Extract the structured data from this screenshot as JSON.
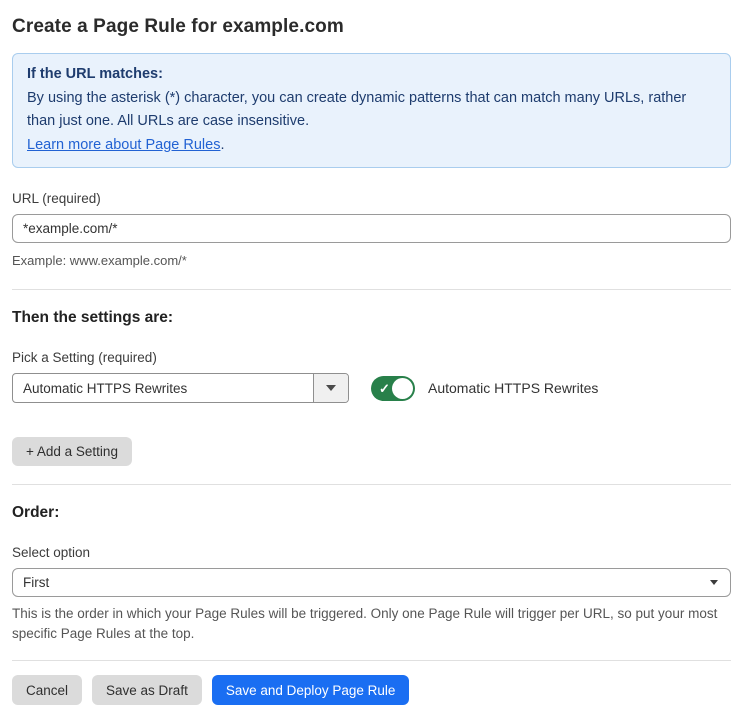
{
  "page": {
    "title": "Create a Page Rule for example.com"
  },
  "info_box": {
    "heading": "If the URL matches:",
    "body": "By using the asterisk (*) character, you can create dynamic patterns that can match many URLs, rather than just one. All URLs are case insensitive.",
    "link_label": "Learn more about Page Rules",
    "link_suffix": ".",
    "background_color": "#e9f2fc",
    "text_color": "#1e3c6e",
    "link_color": "#2262d3"
  },
  "url_field": {
    "label": "URL (required)",
    "value": "*example.com/*",
    "helper": "Example: www.example.com/*"
  },
  "settings_section": {
    "heading": "Then the settings are:",
    "picker_label": "Pick a Setting (required)",
    "selected_setting": "Automatic HTTPS Rewrites",
    "toggle": {
      "state": "on",
      "label": "Automatic HTTPS Rewrites",
      "on_color": "#28804a",
      "check_glyph": "✓"
    },
    "add_button_label": "+ Add a Setting"
  },
  "order_section": {
    "heading": "Order:",
    "select_label": "Select option",
    "selected_option": "First",
    "helper": "This is the order in which your Page Rules will be triggered. Only one Page Rule will trigger per URL, so put your most specific Page Rules at the top."
  },
  "actions": {
    "cancel_label": "Cancel",
    "save_draft_label": "Save as Draft",
    "save_deploy_label": "Save and Deploy Page Rule",
    "primary_color": "#1a6ef2"
  }
}
